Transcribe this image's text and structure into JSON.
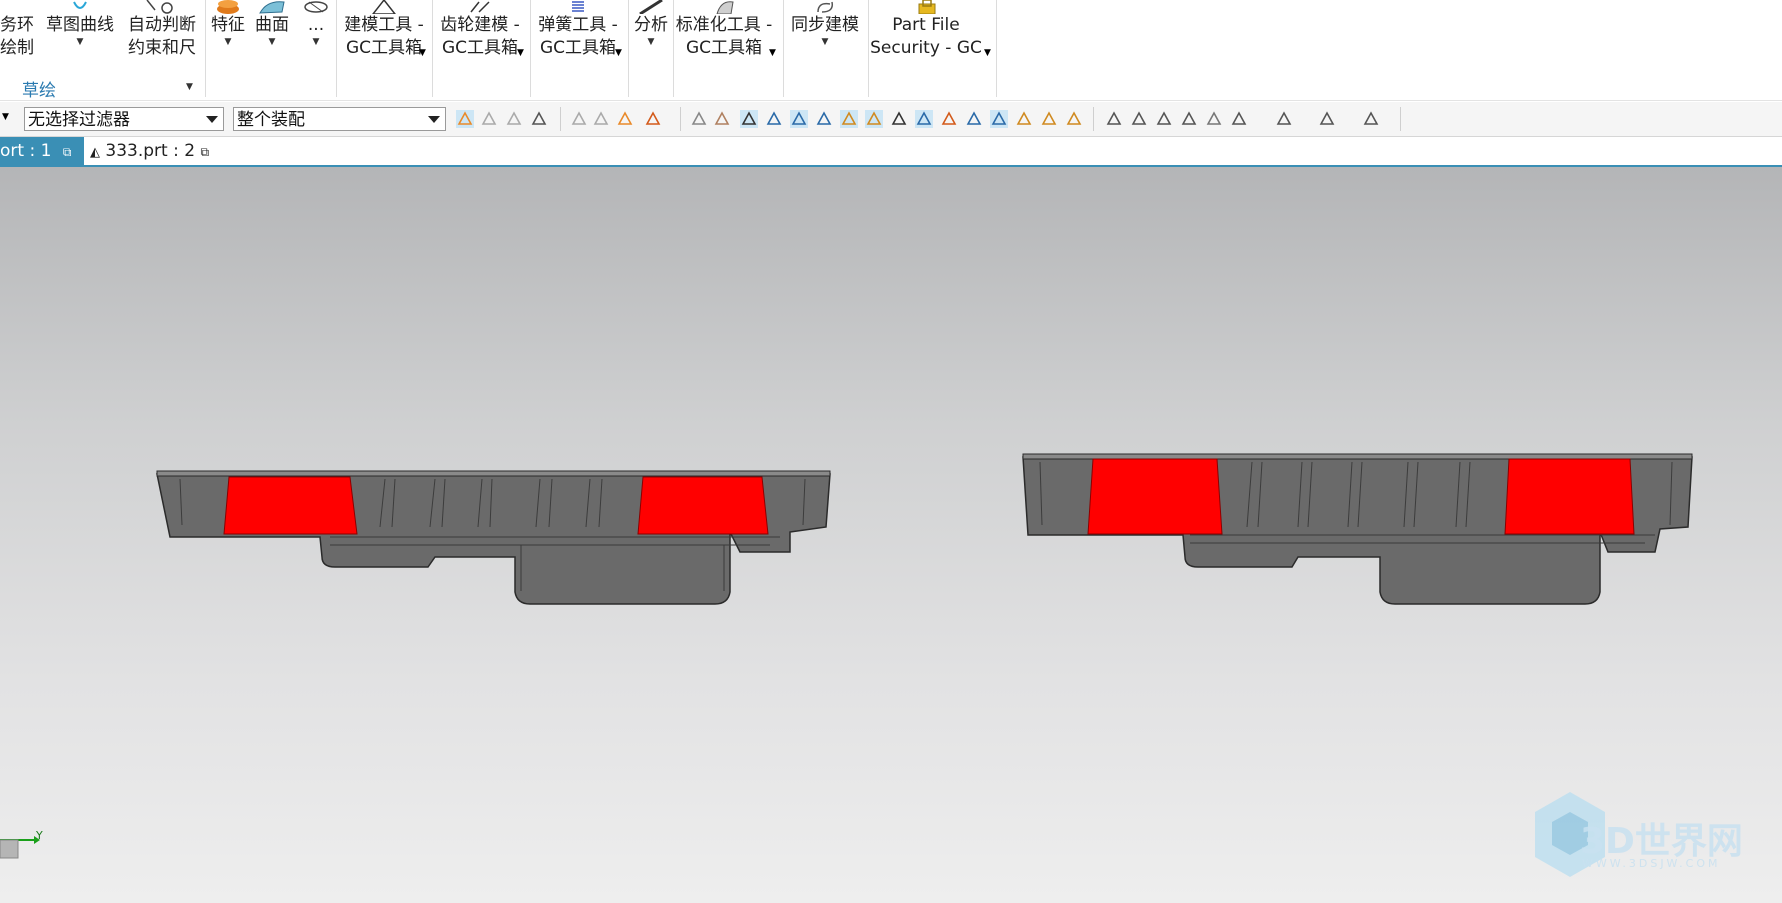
{
  "ribbon": {
    "buttons": [
      {
        "id": "partial-left",
        "line1": "务环",
        "line2": "绘制"
      },
      {
        "id": "sketch-curve",
        "line1": "草图曲线",
        "line2": ""
      },
      {
        "id": "auto-constraint",
        "line1": "自动判断",
        "line2": "约束和尺"
      },
      {
        "id": "feature",
        "line1": "特征",
        "line2": ""
      },
      {
        "id": "surface",
        "line1": "曲面",
        "line2": ""
      },
      {
        "id": "more",
        "line1": "...",
        "line2": ""
      },
      {
        "id": "modeling-tools",
        "line1": "建模工具 -",
        "line2": "GC工具箱"
      },
      {
        "id": "gear-modeling",
        "line1": "齿轮建模 -",
        "line2": "GC工具箱"
      },
      {
        "id": "spring-tools",
        "line1": "弹簧工具 -",
        "line2": "GC工具箱"
      },
      {
        "id": "analysis",
        "line1": "分析",
        "line2": ""
      },
      {
        "id": "standard-tools",
        "line1": "标准化工具 -",
        "line2": "GC工具箱"
      },
      {
        "id": "sync-modeling",
        "line1": "同步建模",
        "line2": ""
      },
      {
        "id": "part-file-security",
        "line1": "Part File",
        "line2": "Security - GC"
      }
    ],
    "group_label": "草绘"
  },
  "selection_bar": {
    "type_filter": "无选择过滤器",
    "scope": "整个装配"
  },
  "tabs": [
    {
      "label": "ort : 1",
      "active": true
    },
    {
      "label": "333.prt : 2",
      "active": false
    }
  ],
  "viewport": {
    "axis_label": "Y",
    "watermark": "3D世界网",
    "watermark_url": "WWW.3DSJW.COM",
    "highlight_color": "#ff0000",
    "body_color": "#6b6b6b"
  }
}
